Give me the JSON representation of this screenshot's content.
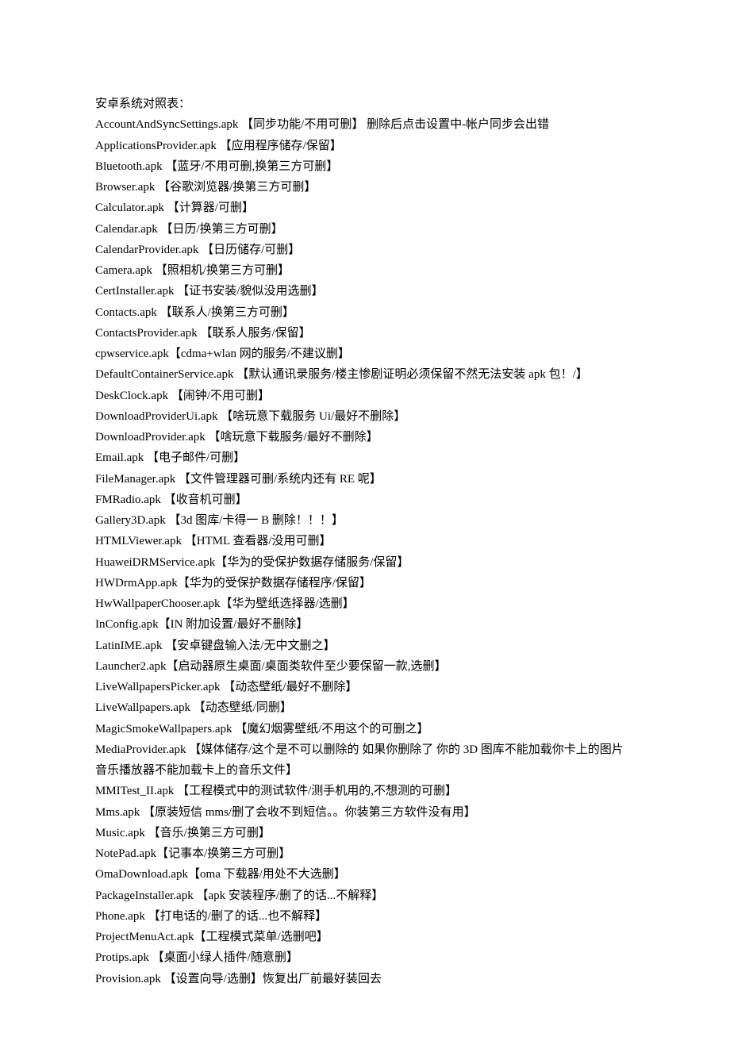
{
  "title": "安卓系统对照表：",
  "lines": [
    "AccountAndSyncSettings.apk 【同步功能/不用可删】 删除后点击设置中-帐户同步会出错",
    "ApplicationsProvider.apk 【应用程序储存/保留】",
    "Bluetooth.apk 【蓝牙/不用可删,换第三方可删】",
    "Browser.apk 【谷歌浏览器/换第三方可删】",
    "Calculator.apk 【计算器/可删】",
    "Calendar.apk 【日历/换第三方可删】",
    "CalendarProvider.apk 【日历储存/可删】",
    "Camera.apk 【照相机/换第三方可删】",
    "CertInstaller.apk 【证书安装/貌似没用选删】",
    "Contacts.apk 【联系人/换第三方可删】",
    "ContactsProvider.apk 【联系人服务/保留】",
    "cpwservice.apk【cdma+wlan 网的服务/不建议删】",
    "DefaultContainerService.apk 【默认通讯录服务/楼主惨剧证明必须保留不然无法安装 apk 包！/】",
    "DeskClock.apk 【闹钟/不用可删】",
    "DownloadProviderUi.apk 【啥玩意下载服务 Ui/最好不删除】",
    "DownloadProvider.apk 【啥玩意下载服务/最好不删除】",
    "Email.apk 【电子邮件/可删】",
    "FileManager.apk 【文件管理器可删/系统内还有 RE 呢】",
    "FMRadio.apk 【收音机可删】",
    "Gallery3D.apk 【3d 图库/卡得一 B 删除！！！】",
    "HTMLViewer.apk 【HTML 查看器/没用可删】",
    "HuaweiDRMService.apk【华为的受保护数据存储服务/保留】",
    "HWDrmApp.apk【华为的受保护数据存储程序/保留】",
    "HwWallpaperChooser.apk【华为壁纸选择器/选删】",
    "InConfig.apk【IN 附加设置/最好不删除】",
    "LatinIME.apk 【安卓键盘输入法/无中文删之】",
    "Launcher2.apk【启动器原生桌面/桌面类软件至少要保留一款,选删】",
    "LiveWallpapersPicker.apk 【动态壁纸/最好不删除】",
    "LiveWallpapers.apk 【动态壁纸/同删】",
    "MagicSmokeWallpapers.apk 【魔幻烟雾壁纸/不用这个的可删之】",
    "MediaProvider.apk 【媒体储存/这个是不可以删除的 如果你删除了 你的 3D 图库不能加载你卡上的图片 音乐播放器不能加载卡上的音乐文件】",
    "MMITest_II.apk 【工程模式中的测试软件/测手机用的,不想测的可删】",
    "Mms.apk 【原装短信 mms/删了会收不到短信。。你装第三方软件没有用】",
    "Music.apk 【音乐/换第三方可删】",
    "NotePad.apk【记事本/换第三方可删】",
    "OmaDownload.apk【oma 下载器/用处不大选删】",
    "PackageInstaller.apk 【apk 安装程序/删了的话...不解释】",
    "Phone.apk 【打电话的/删了的话...也不解释】",
    "ProjectMenuAct.apk【工程模式菜单/选删吧】",
    "Protips.apk 【桌面小绿人插件/随意删】",
    "Provision.apk 【设置向导/选删】恢复出厂前最好装回去"
  ]
}
